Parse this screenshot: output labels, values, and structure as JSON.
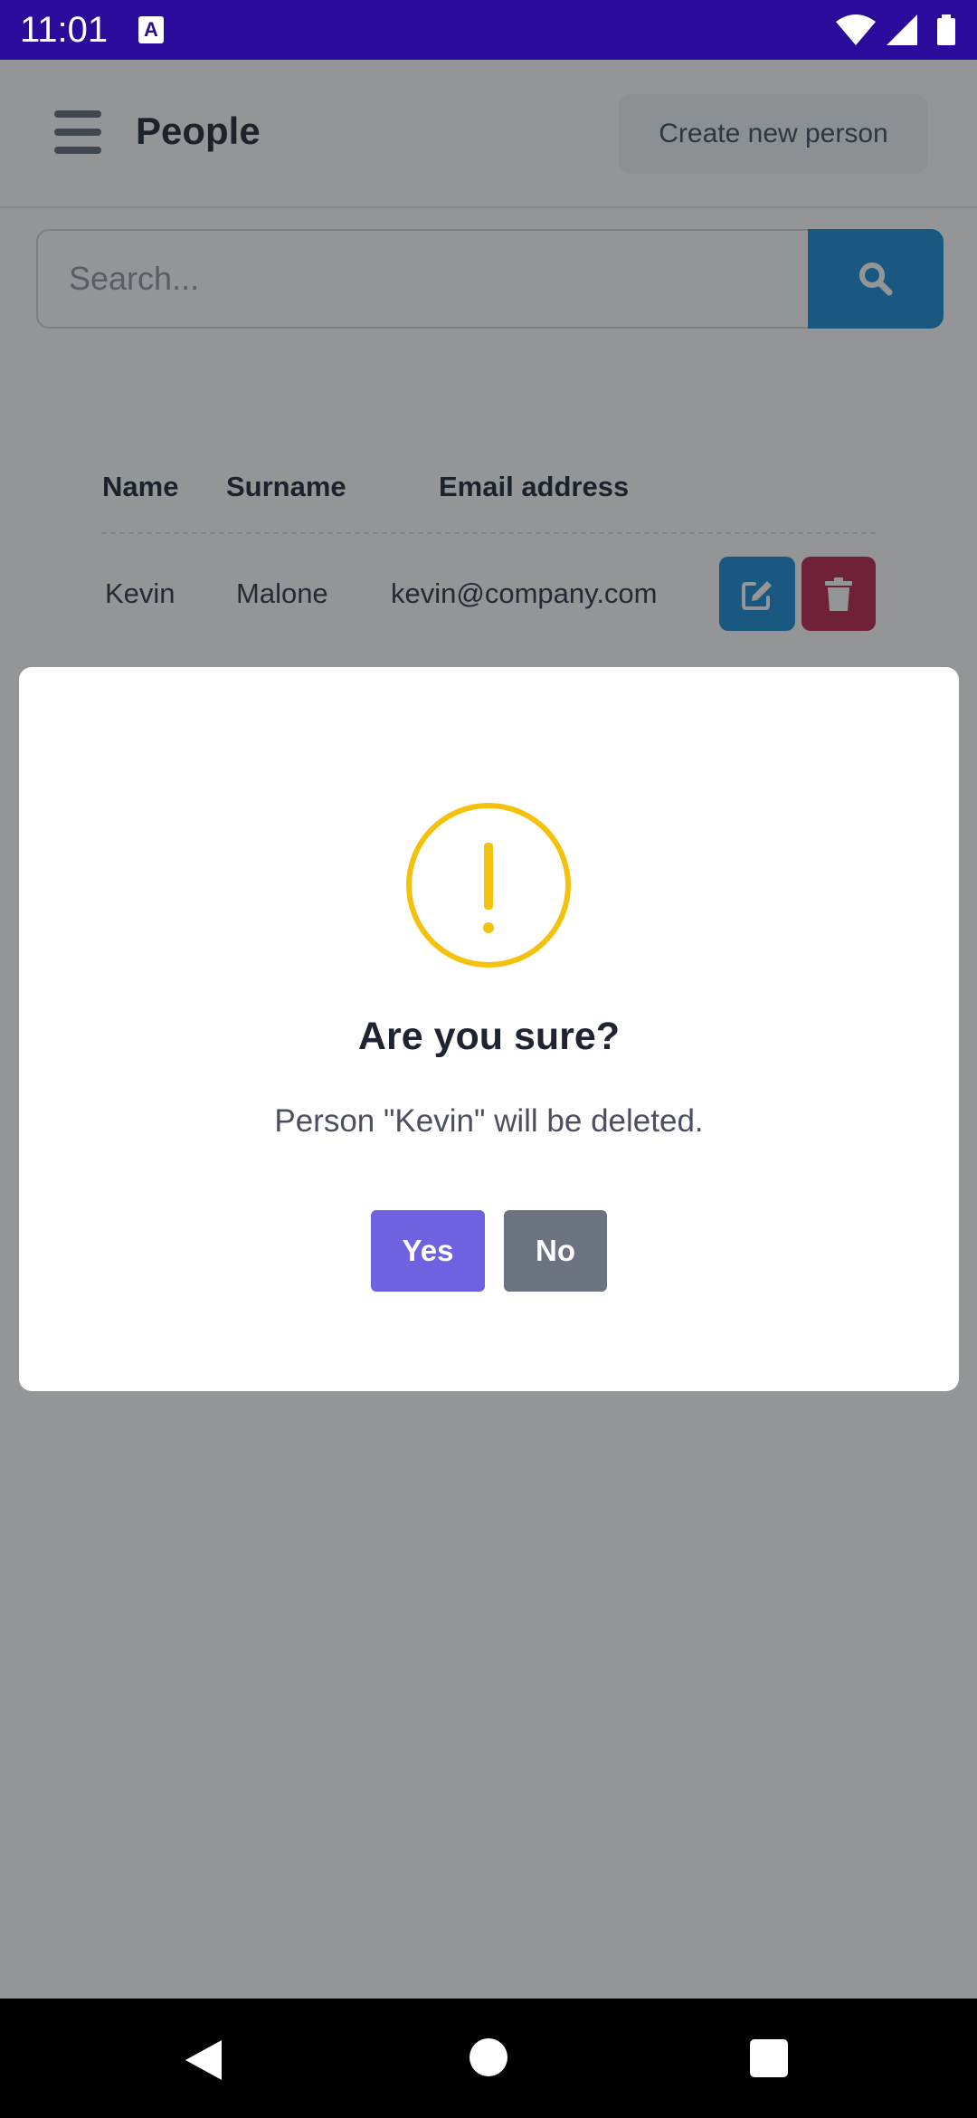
{
  "status_bar": {
    "time": "11:01",
    "notification_icon": "A",
    "icons": [
      "wifi-icon",
      "signal-icon",
      "battery-icon"
    ]
  },
  "header": {
    "title": "People",
    "create_button_label": "Create new person"
  },
  "search": {
    "placeholder": "Search...",
    "value": ""
  },
  "table": {
    "columns": [
      "Name",
      "Surname",
      "Email address"
    ],
    "rows": [
      {
        "name": "Kevin",
        "surname": "Malone",
        "email": "kevin@company.com"
      }
    ]
  },
  "dialog": {
    "title": "Are you sure?",
    "message": "Person \"Kevin\" will be deleted.",
    "confirm_label": "Yes",
    "cancel_label": "No",
    "icon": "warning-icon"
  },
  "colors": {
    "status_bar": "#2a0c9c",
    "primary_blue": "#0b85d1",
    "danger": "#b4163f",
    "confirm": "#6f62e0",
    "cancel": "#6b7380",
    "warning": "#f4c20d"
  }
}
